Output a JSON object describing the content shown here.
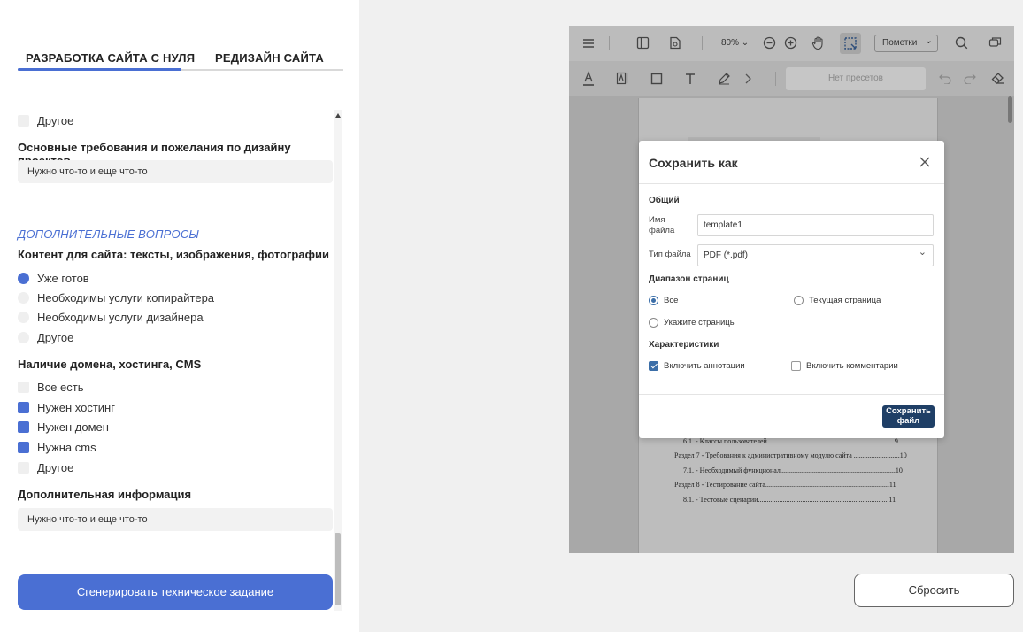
{
  "tabs": [
    "РАЗРАБОТКА САЙТА С НУЛЯ",
    "РЕДИЗАЙН САЙТА"
  ],
  "form": {
    "other_top": "Другое",
    "design_req_label": "Основные требования и пожелания по дизайну проектов",
    "design_req_value": "Нужно что-то и еще что-то",
    "section_title": "ДОПОЛНИТЕЛЬНЫЕ ВОПРОСЫ",
    "content_label": "Контент для сайта: тексты, изображения, фотографии",
    "content_options": [
      {
        "label": "Уже готов",
        "checked": true
      },
      {
        "label": "Необходимы услуги копирайтера",
        "checked": false
      },
      {
        "label": "Необходимы услуги дизайнера",
        "checked": false
      },
      {
        "label": "Другое",
        "checked": false
      }
    ],
    "domain_label": "Наличие домена, хостинга, CMS",
    "domain_options": [
      {
        "label": "Все есть",
        "checked": false
      },
      {
        "label": "Нужен хостинг",
        "checked": true
      },
      {
        "label": "Нужен домен",
        "checked": true
      },
      {
        "label": "Нужна cms",
        "checked": true
      },
      {
        "label": "Другое",
        "checked": false
      }
    ],
    "extra_label": "Дополнительная информация",
    "extra_value": "Нужно что-то и еще что-то",
    "generate_button": "Сгенерировать техническое задание"
  },
  "viewer": {
    "zoom": "80%",
    "marks_select": "Пометки",
    "presets": "Нет пресетов",
    "toc": [
      "6.1. - Классы пользователей........................................................................9",
      "Раздел 7 - Требования к административному модулю сайта ..........................10",
      "7.1. - Необходимый функционал.................................................................10",
      "Раздел 8 - Тестирование сайта......................................................................11",
      "8.1. - Тестовые сценарии..........................................................................11"
    ]
  },
  "dialog": {
    "title": "Сохранить как",
    "general": "Общий",
    "filename_label": "Имя файла",
    "filename_value": "template1",
    "filetype_label": "Тип файла",
    "filetype_value": "PDF (*.pdf)",
    "range_title": "Диапазон страниц",
    "range_all": "Все",
    "range_current": "Текущая страница",
    "range_specify": "Укажите страницы",
    "props_title": "Характеристики",
    "include_annotations": "Включить аннотации",
    "include_comments": "Включить комментарии",
    "save_button": "Сохранить файл"
  },
  "reset_button": "Сбросить",
  "colors": {
    "accent": "#4a6fd3",
    "dialog_button": "#1f3f66"
  }
}
